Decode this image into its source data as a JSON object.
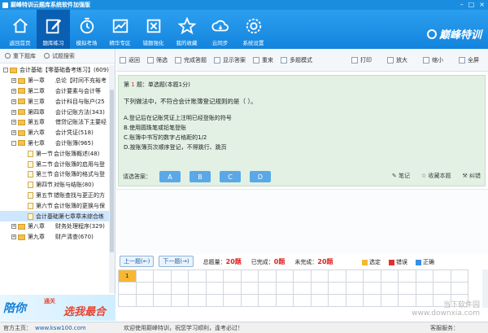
{
  "window": {
    "title": "巅峰特训云题库系统软件加强版",
    "controls": [
      "–",
      "□",
      "×"
    ]
  },
  "ribbon": {
    "items": [
      {
        "label": "返回首页",
        "icon": "home-icon"
      },
      {
        "label": "题库练习",
        "icon": "edit-icon"
      },
      {
        "label": "模拟考场",
        "icon": "timer-icon"
      },
      {
        "label": "精华专区",
        "icon": "chart-icon"
      },
      {
        "label": "错题强化",
        "icon": "error-book-icon"
      },
      {
        "label": "我的收藏",
        "icon": "star-icon"
      },
      {
        "label": "云同步",
        "icon": "cloud-sync-icon"
      },
      {
        "label": "系统设置",
        "icon": "gear-icon"
      }
    ],
    "active": "题库练习",
    "brand": "巅峰特训"
  },
  "left": {
    "tools": [
      "重下题库",
      "试题搜索"
    ],
    "tree": [
      {
        "level": 0,
        "ch": "会计基础【零基础备考练习】",
        "name": "",
        "count": "(609)",
        "exp": "-"
      },
      {
        "level": 1,
        "ch": "第一章",
        "name": "总论【时间不充裕考",
        "count": "",
        "exp": "+"
      },
      {
        "level": 1,
        "ch": "第二章",
        "name": "会计要素与会计等",
        "count": "",
        "exp": "+"
      },
      {
        "level": 1,
        "ch": "第三章",
        "name": "会计科目与账户",
        "count": "(25",
        "exp": "+"
      },
      {
        "level": 1,
        "ch": "第四章",
        "name": "会计记账方法",
        "count": "(343)",
        "exp": "+"
      },
      {
        "level": 1,
        "ch": "第五章",
        "name": "借贷记账法下主要经",
        "count": "",
        "exp": "+"
      },
      {
        "level": 1,
        "ch": "第六章",
        "name": "会计凭证",
        "count": "(518)",
        "exp": "+"
      },
      {
        "level": 1,
        "ch": "第七章",
        "name": "会计账簿",
        "count": "(965)",
        "exp": "-"
      },
      {
        "level": 2,
        "ch": "第一节",
        "name": "会计账簿概述",
        "count": "(48)",
        "exp": ""
      },
      {
        "level": 2,
        "ch": "第二节",
        "name": "会计账簿的启用与登",
        "count": "",
        "exp": ""
      },
      {
        "level": 2,
        "ch": "第三节",
        "name": "会计账簿的格式与登",
        "count": "",
        "exp": ""
      },
      {
        "level": 2,
        "ch": "第四节",
        "name": "对账与结账",
        "count": "(80)",
        "exp": ""
      },
      {
        "level": 2,
        "ch": "第五节",
        "name": "错账查找与更正的方",
        "count": "",
        "exp": ""
      },
      {
        "level": 2,
        "ch": "第六节",
        "name": "会计账簿的更换与保",
        "count": "",
        "exp": ""
      },
      {
        "level": 2,
        "ch": "会计基础第七章章末综合练",
        "name": "",
        "count": "",
        "exp": ""
      },
      {
        "level": 1,
        "ch": "第八章",
        "name": "财务处理程序",
        "count": "(329)",
        "exp": "+"
      },
      {
        "level": 1,
        "ch": "第九章",
        "name": "财产清查",
        "count": "(670)",
        "exp": "+"
      }
    ],
    "ad": {
      "line1": "陪你",
      "line2": "通关",
      "line3": "选我最合适"
    }
  },
  "toolbar": {
    "left": [
      "返回",
      "筛选",
      "完成答题",
      "显示答案",
      "重来",
      "多题模式"
    ],
    "right": [
      "打印",
      "放大",
      "缩小",
      "全屏"
    ]
  },
  "question": {
    "prefix": "第",
    "num": "1",
    "suffix": "题：单选题(本题1分)",
    "stem": "下列做法中，不符合会计账簿登记规则的是（ ）。",
    "options": [
      "A.登记后在记账凭证上注明已经登账的符号",
      "B.使用圆珠笔或铅笔登账",
      "C.账簿中书写的数字占格距的1/2",
      "D.按账簿页次顺序登记，不得跳行、跳页"
    ]
  },
  "answer": {
    "label": "请选答案：",
    "choices": [
      "A",
      "B",
      "C",
      "D"
    ],
    "tools": [
      "笔记",
      "收藏本题",
      "纠错"
    ]
  },
  "nav": {
    "prev": "上一题(←)",
    "next": "下一题(→)",
    "total_label": "总题量：",
    "total": "20题",
    "done_label": "已完成：",
    "done": "0题",
    "todo_label": "未完成：",
    "todo": "20题",
    "legend": [
      {
        "label": "选定",
        "color": "#f7b733"
      },
      {
        "label": "错误",
        "color": "#e03030"
      },
      {
        "label": "正确",
        "color": "#3a8ee8"
      }
    ],
    "current": "1"
  },
  "status": {
    "home_label": "官方主页：",
    "url": "www.ksw100.com",
    "welcome": "欢迎使用巅峰特训，祝您学习顺利，逢考必过！",
    "service": "客服服务："
  },
  "watermark": {
    "line1": "当下软件园",
    "line2": "www.downxia.com"
  }
}
